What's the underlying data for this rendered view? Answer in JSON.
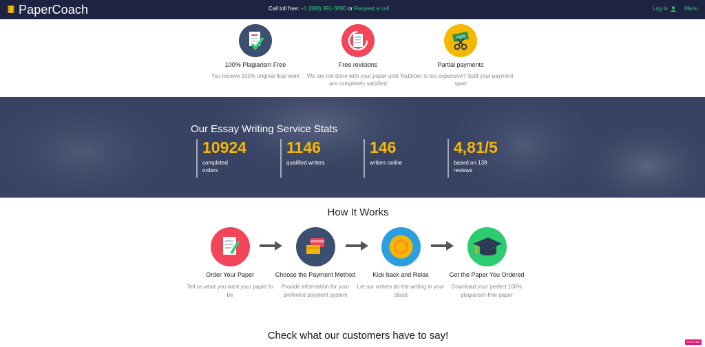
{
  "header": {
    "logo": "PaperCoach",
    "toll_label": "Call toll free:",
    "phone": "+1 (888) 991-3890",
    "or": "or",
    "request_call": "Request a call",
    "login": "Log in",
    "menu": "Menu"
  },
  "features": [
    {
      "title": "100% Plagiarism Free",
      "desc": "You receive 100% original final work",
      "color": "#3d4f6e",
      "icon": "document-check-icon"
    },
    {
      "title": "Free revisions",
      "desc": "We are not done with your paper until You are completely satisfied",
      "color": "#f2455a",
      "icon": "revision-icon"
    },
    {
      "title": "Partial payments",
      "desc": "Order is too expensive? Split your payment spart",
      "color": "#f5b800",
      "icon": "scissors-money-icon"
    }
  ],
  "stats": {
    "title": "Our Essay Writing Service Stats",
    "items": [
      {
        "value": "10924",
        "label": "completed orders"
      },
      {
        "value": "1146",
        "label": "qualified writers"
      },
      {
        "value": "146",
        "label": "writers online"
      },
      {
        "value": "4,81/5",
        "label": "based on 139 reviews"
      }
    ],
    "accent": "#f5b800"
  },
  "how": {
    "title": "How It Works",
    "steps": [
      {
        "title": "Order Your Paper",
        "desc": "Tell us what you want your paper to be",
        "color": "#f2455a",
        "icon": "order-paper-icon"
      },
      {
        "title": "Choose the Payment Method",
        "desc": "Provide information for your preferred payment system",
        "color": "#3d4f6e",
        "icon": "payment-cards-icon"
      },
      {
        "title": "Kick back and Relax",
        "desc": "Let our writers do the writing in your stead",
        "color": "#2b9ee0",
        "icon": "sun-icon"
      },
      {
        "title": "Get the Paper You Ordered",
        "desc": "Download your perfect 100% plagiarism-free paper",
        "color": "#2ecc71",
        "icon": "graduation-cap-icon"
      }
    ]
  },
  "customers_title": "Check what our customers have to say!",
  "badge": "Point It Me"
}
